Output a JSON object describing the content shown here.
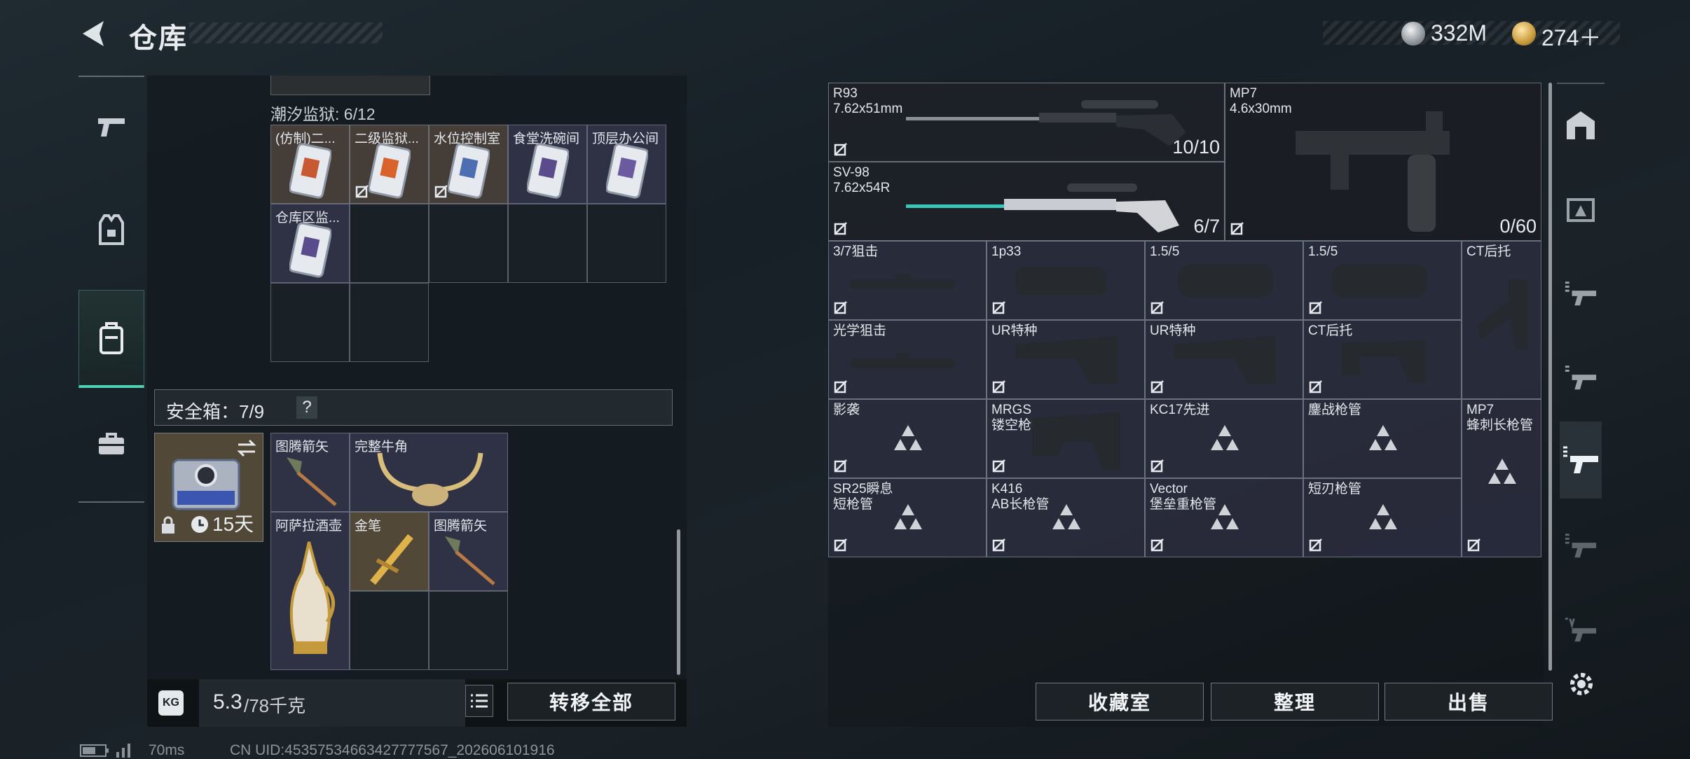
{
  "header": {
    "title": "仓库",
    "currency": [
      {
        "icon": "silver-coin-icon",
        "value": "332M"
      },
      {
        "icon": "gold-coin-icon",
        "value": "274＋"
      }
    ]
  },
  "left_nav": [
    {
      "icon": "pistol-icon"
    },
    {
      "icon": "armor-vest-icon"
    },
    {
      "icon": "backpack-icon",
      "active": true
    },
    {
      "icon": "briefcase-icon"
    }
  ],
  "storage": {
    "section_label": "潮汐监狱: 6/12",
    "items": [
      "(仿制)二...",
      "二级监狱...",
      "水位控制室",
      "食堂洗碗间",
      "顶层办公间",
      "仓库区监..."
    ]
  },
  "safe_box": {
    "label": "安全箱：7/9",
    "help": "?",
    "timer": "15天",
    "items": [
      "图腾箭矢",
      "完整牛角",
      "阿萨拉酒壶",
      "金笔",
      "图腾箭矢"
    ]
  },
  "footer_left": {
    "weight": "5.3",
    "weight_max": "/78千克",
    "transfer_all": "转移全部"
  },
  "weapons": [
    {
      "name": "R93",
      "caliber": "7.62x51mm",
      "ammo": "10/10"
    },
    {
      "name": "SV-98",
      "caliber": "7.62x54R",
      "ammo": "6/7"
    },
    {
      "name": "MP7",
      "caliber": "4.6x30mm",
      "ammo": "0/60"
    }
  ],
  "parts": [
    {
      "l1": "3/7狙击",
      "l2": ""
    },
    {
      "l1": "1p33",
      "l2": ""
    },
    {
      "l1": "1.5/5",
      "l2": ""
    },
    {
      "l1": "1.5/5",
      "l2": ""
    },
    {
      "l1": "CT后托",
      "l2": ""
    },
    {
      "l1": "光学狙击",
      "l2": ""
    },
    {
      "l1": "UR特种",
      "l2": ""
    },
    {
      "l1": "UR特种",
      "l2": ""
    },
    {
      "l1": "CT后托",
      "l2": ""
    },
    {
      "l1": "影袭",
      "l2": ""
    },
    {
      "l1": "MRGS",
      "l2": "镂空枪托"
    },
    {
      "l1": "KC17先进",
      "l2": ""
    },
    {
      "l1": "鏖战枪管",
      "l2": ""
    },
    {
      "l1": "MP7",
      "l2": "蜂刺长枪管"
    },
    {
      "l1": "SR25瞬息",
      "l2": "短枪管"
    },
    {
      "l1": "K416",
      "l2": "AB长枪管"
    },
    {
      "l1": "Vector",
      "l2": "堡垒重枪管"
    },
    {
      "l1": "短刃枪管",
      "l2": ""
    }
  ],
  "footer_right": {
    "collection": "收藏室",
    "sort": "整理",
    "sell": "出售"
  },
  "status": {
    "ping": "70ms",
    "uid": "CN UID:45357534663427777567_202606101916"
  }
}
